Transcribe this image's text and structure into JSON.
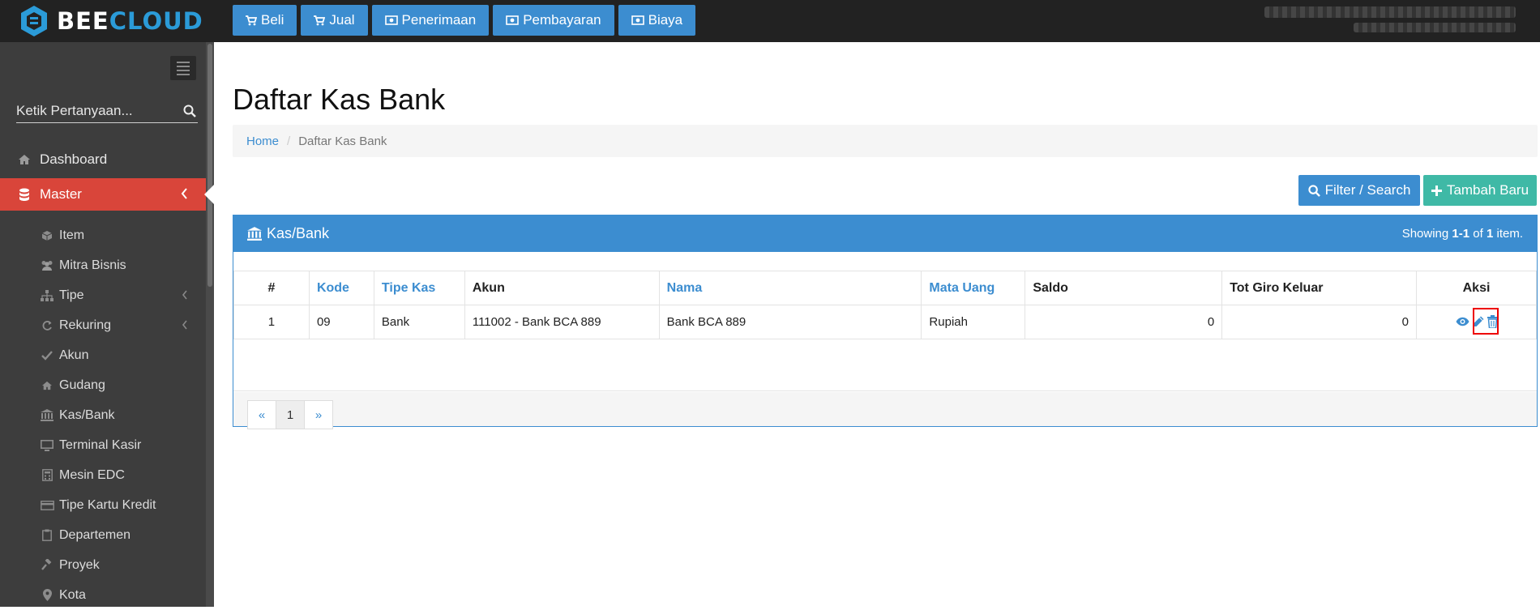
{
  "brand": {
    "part1": "BEE",
    "part2": "CLOUD",
    "accent": "#2b9bd8"
  },
  "topnav": [
    {
      "label": "Beli",
      "icon": "cart-icon"
    },
    {
      "label": "Jual",
      "icon": "cart-icon"
    },
    {
      "label": "Penerimaan",
      "icon": "money-icon"
    },
    {
      "label": "Pembayaran",
      "icon": "money-icon"
    },
    {
      "label": "Biaya",
      "icon": "money-icon"
    }
  ],
  "sidebar": {
    "search_placeholder": "Ketik Pertanyaan...",
    "items": [
      {
        "label": "Dashboard",
        "icon": "home-icon"
      },
      {
        "label": "Master",
        "icon": "database-icon",
        "active": true
      }
    ],
    "subitems": [
      {
        "label": "Item",
        "icon": "cube-icon"
      },
      {
        "label": "Mitra Bisnis",
        "icon": "users-icon"
      },
      {
        "label": "Tipe",
        "icon": "sitemap-icon"
      },
      {
        "label": "Rekuring",
        "icon": "refresh-icon"
      },
      {
        "label": "Akun",
        "icon": "check-icon"
      },
      {
        "label": "Gudang",
        "icon": "home-icon"
      },
      {
        "label": "Kas/Bank",
        "icon": "bank-icon"
      },
      {
        "label": "Terminal Kasir",
        "icon": "monitor-icon"
      },
      {
        "label": "Mesin EDC",
        "icon": "calculator-icon"
      },
      {
        "label": "Tipe Kartu Kredit",
        "icon": "credit-card-icon"
      },
      {
        "label": "Departemen",
        "icon": "clipboard-icon"
      },
      {
        "label": "Proyek",
        "icon": "gavel-icon"
      },
      {
        "label": "Kota",
        "icon": "map-marker-icon"
      }
    ]
  },
  "page": {
    "title": "Daftar Kas Bank",
    "breadcrumb_home": "Home",
    "breadcrumb_sep": "/",
    "breadcrumb_current": "Daftar Kas Bank"
  },
  "actions": {
    "filter_label": "Filter / Search",
    "add_label": "Tambah Baru"
  },
  "panel": {
    "title": "Kas/Bank",
    "summary_prefix": "Showing ",
    "summary_range": "1-1",
    "summary_mid": " of ",
    "summary_total": "1",
    "summary_suffix": " item."
  },
  "table": {
    "headers": [
      "#",
      "Kode",
      "Tipe Kas",
      "Akun",
      "Nama",
      "Mata Uang",
      "Saldo",
      "Tot Giro Keluar",
      "Aksi"
    ],
    "rows": [
      {
        "no": "1",
        "kode": "09",
        "tipe_kas": "Bank",
        "akun": "111002 - Bank BCA 889",
        "nama": "Bank BCA 889",
        "mata_uang": "Rupiah",
        "saldo": "0",
        "tot_giro": "0"
      }
    ]
  },
  "pager": {
    "prev": "«",
    "page": "1",
    "next": "»"
  },
  "colors": {
    "primary": "#3c8dd0",
    "success": "#3fb9a6",
    "active": "#d9453a",
    "sidebar": "#3d3d3d",
    "topbar": "#222222"
  }
}
